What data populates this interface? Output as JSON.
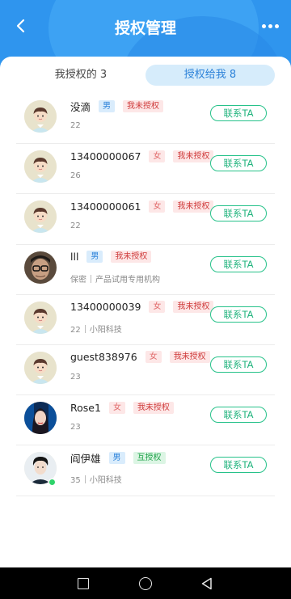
{
  "header": {
    "title": "授权管理"
  },
  "tabs": {
    "left": "我授权的 3",
    "right": "授权给我 8"
  },
  "items": [
    {
      "name": "没滴",
      "gender": "男",
      "status": "我未授权",
      "age": "22",
      "org": "",
      "avatar": "default",
      "button": "联系TA"
    },
    {
      "name": "13400000067",
      "gender": "女",
      "status": "我未授权",
      "age": "26",
      "org": "",
      "avatar": "default",
      "button": "联系TA"
    },
    {
      "name": "13400000061",
      "gender": "女",
      "status": "我未授权",
      "age": "22",
      "org": "",
      "avatar": "default",
      "button": "联系TA"
    },
    {
      "name": "lll",
      "gender": "男",
      "status": "我未授权",
      "age": "保密",
      "org": "产品试用专用机构",
      "avatar": "photo-glasses",
      "button": "联系TA"
    },
    {
      "name": "13400000039",
      "gender": "女",
      "status": "我未授权",
      "age": "22",
      "org": "小阳科技",
      "avatar": "default",
      "button": "联系TA"
    },
    {
      "name": "guest838976",
      "gender": "女",
      "status": "我未授权",
      "age": "23",
      "org": "",
      "avatar": "default",
      "button": "联系TA"
    },
    {
      "name": "Rose1",
      "gender": "女",
      "status": "我未授权",
      "age": "23",
      "org": "",
      "avatar": "photo-woman",
      "button": "联系TA"
    },
    {
      "name": "阎伊雄",
      "gender": "男",
      "status": "互授权",
      "age": "35",
      "org": "小阳科技",
      "avatar": "photo-man",
      "online": true,
      "button": "联系TA"
    }
  ],
  "colors": {
    "header_blue": "#2f95ee",
    "contact_green": "#22b47e",
    "tab_active_bg": "#d6ecfb"
  }
}
